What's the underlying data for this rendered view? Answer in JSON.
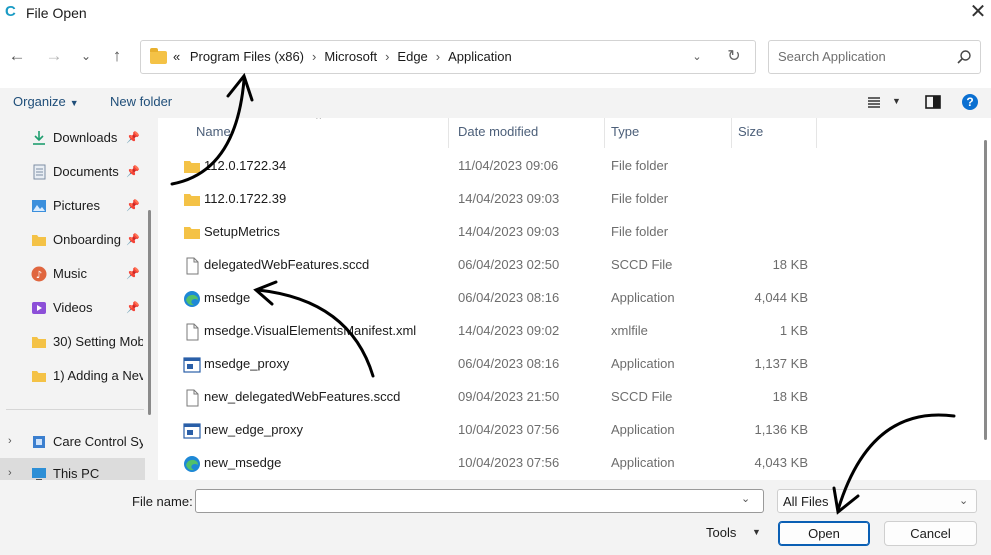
{
  "window": {
    "title": "File Open",
    "app_icon_letter": "C"
  },
  "address": {
    "crumbs": [
      "«",
      "Program Files (x86)",
      "Microsoft",
      "Edge",
      "Application"
    ]
  },
  "search": {
    "placeholder": "Search Application"
  },
  "toolbar": {
    "organize": "Organize",
    "new_folder": "New folder"
  },
  "sidebar": {
    "items": [
      {
        "label": "Downloads",
        "icon": "download-icon",
        "pinned": true
      },
      {
        "label": "Documents",
        "icon": "document-icon",
        "pinned": true
      },
      {
        "label": "Pictures",
        "icon": "pictures-icon",
        "pinned": true
      },
      {
        "label": "Onboarding",
        "icon": "folder-icon",
        "pinned": true
      },
      {
        "label": "Music",
        "icon": "music-icon",
        "pinned": true
      },
      {
        "label": "Videos",
        "icon": "videos-icon",
        "pinned": true
      },
      {
        "label": "30) Setting Mob",
        "icon": "folder-icon",
        "pinned": false
      },
      {
        "label": "1) Adding a Nev",
        "icon": "folder-icon",
        "pinned": false
      },
      {
        "label": "Care Control Sy",
        "icon": "network-drive-icon",
        "pinned": false
      },
      {
        "label": "This PC",
        "icon": "computer-icon",
        "pinned": false
      }
    ]
  },
  "columns": {
    "name": "Name",
    "date": "Date modified",
    "type": "Type",
    "size": "Size"
  },
  "files": [
    {
      "name": "112.0.1722.34",
      "date": "11/04/2023 09:06",
      "type": "File folder",
      "size": "",
      "icon": "folder-icon"
    },
    {
      "name": "112.0.1722.39",
      "date": "14/04/2023 09:03",
      "type": "File folder",
      "size": "",
      "icon": "folder-icon"
    },
    {
      "name": "SetupMetrics",
      "date": "14/04/2023 09:03",
      "type": "File folder",
      "size": "",
      "icon": "folder-icon"
    },
    {
      "name": "delegatedWebFeatures.sccd",
      "date": "06/04/2023 02:50",
      "type": "SCCD File",
      "size": "18 KB",
      "icon": "file-icon"
    },
    {
      "name": "msedge",
      "date": "06/04/2023 08:16",
      "type": "Application",
      "size": "4,044 KB",
      "icon": "edge-icon"
    },
    {
      "name": "msedge.VisualElementsManifest.xml",
      "date": "14/04/2023 09:02",
      "type": "xmlfile",
      "size": "1 KB",
      "icon": "file-icon"
    },
    {
      "name": "msedge_proxy",
      "date": "06/04/2023 08:16",
      "type": "Application",
      "size": "1,137 KB",
      "icon": "app-window-icon"
    },
    {
      "name": "new_delegatedWebFeatures.sccd",
      "date": "09/04/2023 21:50",
      "type": "SCCD File",
      "size": "18 KB",
      "icon": "file-icon"
    },
    {
      "name": "new_edge_proxy",
      "date": "10/04/2023 07:56",
      "type": "Application",
      "size": "1,136 KB",
      "icon": "app-window-icon"
    },
    {
      "name": "new_msedge",
      "date": "10/04/2023 07:56",
      "type": "Application",
      "size": "4,043 KB",
      "icon": "edge-icon"
    }
  ],
  "footer": {
    "file_name_label": "File name:",
    "file_name_value": "",
    "filter": "All Files",
    "tools": "Tools",
    "open": "Open",
    "cancel": "Cancel"
  },
  "colors": {
    "accent": "#0a5fb4",
    "folder": "#f4c246",
    "link": "#1f4e79"
  }
}
